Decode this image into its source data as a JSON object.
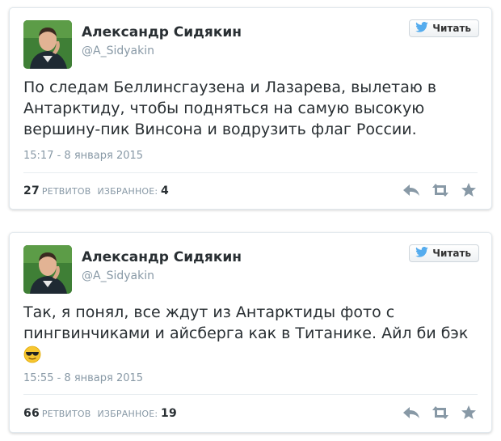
{
  "tweets": [
    {
      "author_name": "Александр Сидякин",
      "author_handle": "@A_Sidyakin",
      "follow_label": "Читать",
      "text": "По следам Беллинсгаузена и Лазарева, вылетаю в Антарктиду, чтобы подняться на самую высокую вершину-пик Винсона и водрузить флаг России.",
      "timestamp": "15:17 - 8 января 2015",
      "retweets_count": "27",
      "retweets_label": "РЕТВИТОВ",
      "favorites_label": "ИЗБРАННОЕ:",
      "favorites_count": "4",
      "has_emoji": false
    },
    {
      "author_name": "Александр Сидякин",
      "author_handle": "@A_Sidyakin",
      "follow_label": "Читать",
      "text": "Так, я понял, все ждут из Антарктиды фото с пингвинчиками и айсберга как в Титанике. Айл би бэк",
      "emoji": "sunglasses-emoji",
      "timestamp": "15:55 - 8 января 2015",
      "retweets_count": "66",
      "retweets_label": "РЕТВИТОВ",
      "favorites_label": "ИЗБРАННОЕ:",
      "favorites_count": "19",
      "has_emoji": true
    }
  ],
  "icons": {
    "follow": "twitter-bird-icon",
    "reply": "reply-icon",
    "retweet": "retweet-icon",
    "favorite": "star-icon"
  },
  "colors": {
    "twitter_blue": "#55acee",
    "text": "#292f33",
    "muted": "#8899a6",
    "action_icon": "#8899a6"
  }
}
